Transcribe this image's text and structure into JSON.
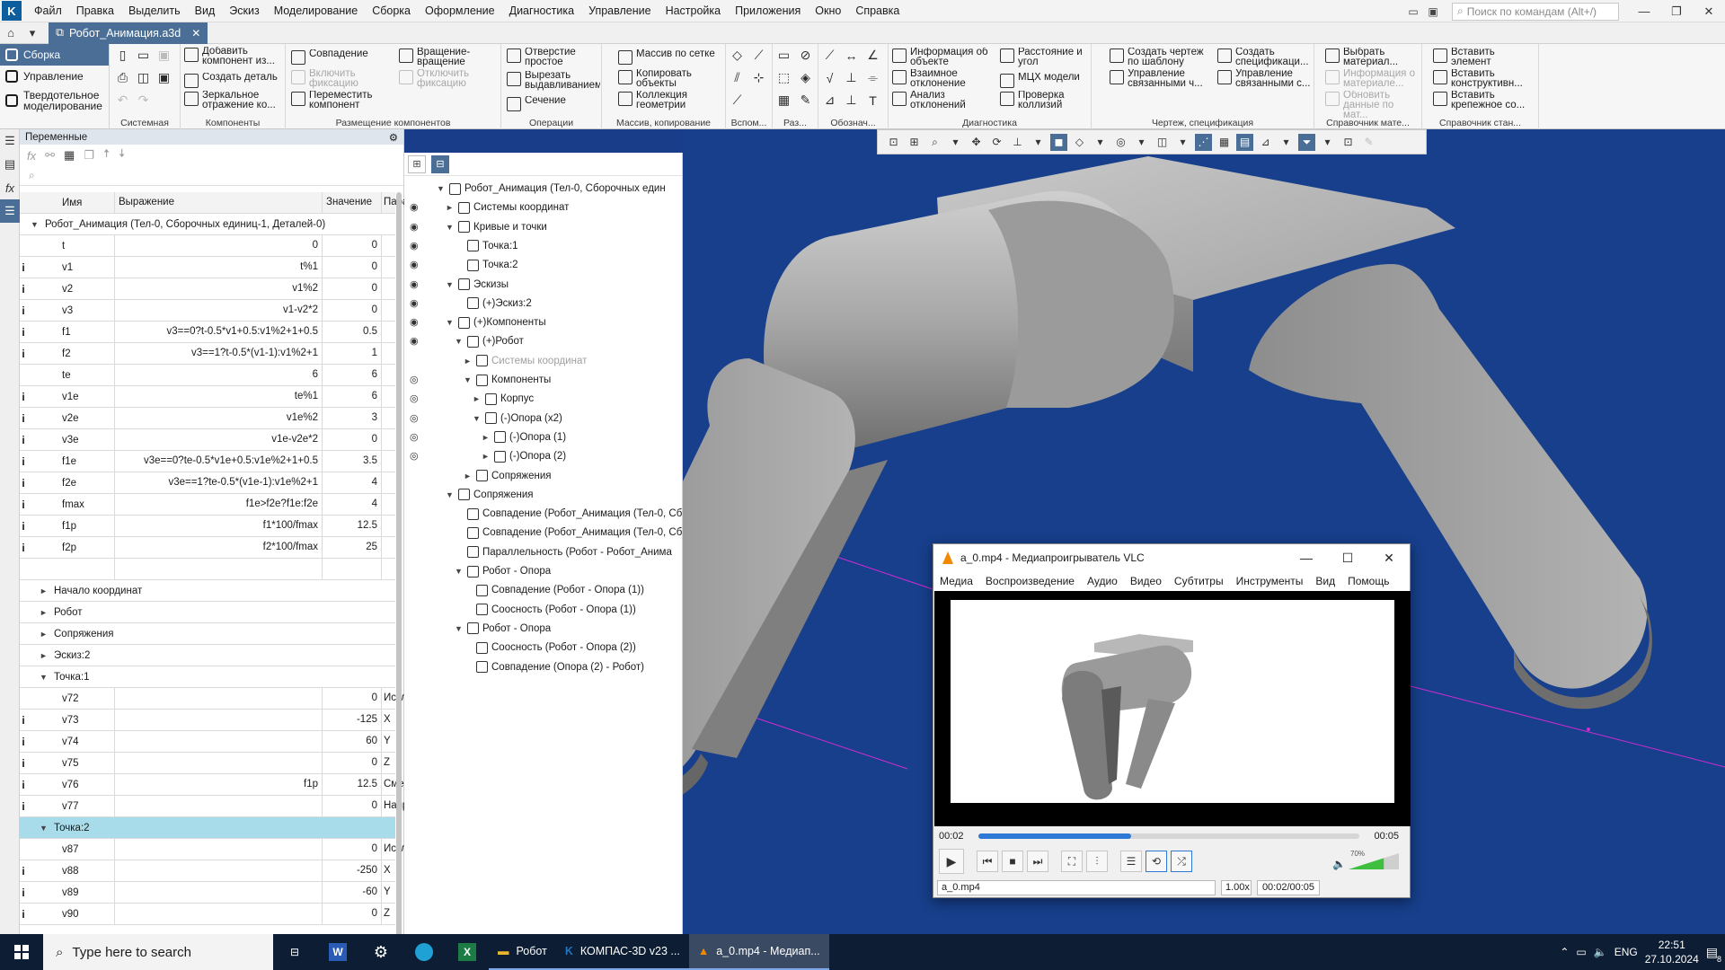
{
  "menubar": {
    "items": [
      "Файл",
      "Правка",
      "Выделить",
      "Вид",
      "Эскиз",
      "Моделирование",
      "Сборка",
      "Оформление",
      "Диагностика",
      "Управление",
      "Настройка",
      "Приложения",
      "Окно",
      "Справка"
    ],
    "search_placeholder": "Поиск по командам (Alt+/)"
  },
  "tab": {
    "title": "Робот_Анимация.a3d"
  },
  "ribbon": {
    "modes": [
      "Сборка",
      "Управление",
      "Твердотельное моделирование"
    ],
    "groups": [
      "Системная",
      "Компоненты",
      "Размещение компонентов",
      "Операции",
      "Массив, копирование",
      "Вспом...",
      "Раз...",
      "Обознач...",
      "Диагностика",
      "Чертеж, спецификация",
      "Справочник мате...",
      "Справочник стан..."
    ],
    "commands": {
      "add_component": "Добавить компонент из...",
      "create_part": "Создать деталь",
      "mirror": "Зеркальное отражение ко...",
      "coincidence": "Совпадение",
      "enable_fix": "Включить фиксацию",
      "disable_fix": "Отключить фиксацию",
      "move_component": "Переместить компонент",
      "rotate": "Вращение-вращение",
      "hole": "Отверстие простое",
      "cut_extrude": "Вырезать выдавливанием",
      "section": "Сечение",
      "pattern_grid": "Массив по сетке",
      "copy_objects": "Копировать объекты",
      "geometry_collection": "Коллекция геометрии",
      "object_info": "Информация об объекте",
      "mutual_deviation": "Взаимное отклонение",
      "deviation_analysis": "Анализ отклонений",
      "distance_angle": "Расстояние и угол",
      "mcc_model": "МЦХ модели",
      "collision_check": "Проверка коллизий",
      "create_drawing": "Создать чертеж по шаблону",
      "control_linked": "Управление связанными ч...",
      "create_spec": "Создать спецификаци...",
      "control_linked2": "Управление связанными с...",
      "choose_material": "Выбрать материал...",
      "material_info": "Информация о материале...",
      "update_material": "Обновить данные по мат...",
      "insert_element": "Вставить элемент",
      "insert_design": "Вставить конструктивн...",
      "insert_fastener": "Вставить крепежное со..."
    }
  },
  "variables": {
    "panel_title": "Переменные",
    "columns": [
      "Имя",
      "Выражение",
      "Значение",
      "Парам"
    ],
    "root_group": "Робот_Анимация (Тел-0, Сборочных единиц-1, Деталей-0)",
    "rows": [
      {
        "i": "",
        "name": "t",
        "expr": "0",
        "val": "0"
      },
      {
        "i": "i",
        "name": "v1",
        "expr": "t%1",
        "val": "0"
      },
      {
        "i": "i",
        "name": "v2",
        "expr": "v1%2",
        "val": "0"
      },
      {
        "i": "i",
        "name": "v3",
        "expr": "v1-v2*2",
        "val": "0"
      },
      {
        "i": "i",
        "name": "f1",
        "expr": "v3==0?t-0.5*v1+0.5:v1%2+1+0.5",
        "val": "0.5"
      },
      {
        "i": "i",
        "name": "f2",
        "expr": "v3==1?t-0.5*(v1-1):v1%2+1",
        "val": "1"
      },
      {
        "i": "",
        "name": "te",
        "expr": "6",
        "val": "6"
      },
      {
        "i": "i",
        "name": "v1e",
        "expr": "te%1",
        "val": "6"
      },
      {
        "i": "i",
        "name": "v2e",
        "expr": "v1e%2",
        "val": "3"
      },
      {
        "i": "i",
        "name": "v3e",
        "expr": "v1e-v2e*2",
        "val": "0"
      },
      {
        "i": "i",
        "name": "f1e",
        "expr": "v3e==0?te-0.5*v1e+0.5:v1e%2+1+0.5",
        "val": "3.5"
      },
      {
        "i": "i",
        "name": "f2e",
        "expr": "v3e==1?te-0.5*(v1e-1):v1e%2+1",
        "val": "4"
      },
      {
        "i": "i",
        "name": "fmax",
        "expr": "f1e>f2e?f1e:f2e",
        "val": "4"
      },
      {
        "i": "i",
        "name": "f1p",
        "expr": "f1*100/fmax",
        "val": "12.5"
      },
      {
        "i": "i",
        "name": "f2p",
        "expr": "f2*100/fmax",
        "val": "25"
      }
    ],
    "groups": [
      "Начало координат",
      "Робот",
      "Сопряжения",
      "Эскиз:2"
    ],
    "point1": {
      "label": "Точка:1",
      "rows": [
        {
          "i": "",
          "name": "v72",
          "expr": "",
          "val": "0",
          "par": "Искл"
        },
        {
          "i": "i",
          "name": "v73",
          "expr": "",
          "val": "-125",
          "par": "X"
        },
        {
          "i": "i",
          "name": "v74",
          "expr": "",
          "val": "60",
          "par": "Y"
        },
        {
          "i": "i",
          "name": "v75",
          "expr": "",
          "val": "0",
          "par": "Z"
        },
        {
          "i": "i",
          "name": "v76",
          "expr": "f1p",
          "val": "12.5",
          "par": "Смещ"
        },
        {
          "i": "i",
          "name": "v77",
          "expr": "",
          "val": "0",
          "par": "Напр"
        }
      ]
    },
    "point2": {
      "label": "Точка:2",
      "rows": [
        {
          "i": "",
          "name": "v87",
          "expr": "",
          "val": "0",
          "par": "Искл"
        },
        {
          "i": "i",
          "name": "v88",
          "expr": "",
          "val": "-250",
          "par": "X"
        },
        {
          "i": "i",
          "name": "v89",
          "expr": "",
          "val": "-60",
          "par": "Y"
        },
        {
          "i": "i",
          "name": "v90",
          "expr": "",
          "val": "0",
          "par": "Z"
        }
      ]
    }
  },
  "tree": {
    "nodes": [
      {
        "text": "Робот_Анимация (Тел-0, Сборочных един",
        "level": 0,
        "arrow": "▼",
        "eye": ""
      },
      {
        "text": "Системы координат",
        "level": 1,
        "arrow": "►",
        "eye": "◉"
      },
      {
        "text": "Кривые и точки",
        "level": 1,
        "arrow": "▼",
        "eye": "◉"
      },
      {
        "text": "Точка:1",
        "level": 2,
        "arrow": "",
        "eye": "◉"
      },
      {
        "text": "Точка:2",
        "level": 2,
        "arrow": "",
        "eye": "◉"
      },
      {
        "text": "Эскизы",
        "level": 1,
        "arrow": "▼",
        "eye": "◉"
      },
      {
        "text": "(+)Эскиз:2",
        "level": 2,
        "arrow": "",
        "eye": "◉"
      },
      {
        "text": "(+)Компоненты",
        "level": 1,
        "arrow": "▼",
        "eye": "◉"
      },
      {
        "text": "(+)Робот",
        "level": 2,
        "arrow": "▼",
        "eye": "◉"
      },
      {
        "text": "Системы координат",
        "level": 3,
        "arrow": "►",
        "eye": "",
        "dim": true
      },
      {
        "text": "Компоненты",
        "level": 3,
        "arrow": "▼",
        "eye": "◎"
      },
      {
        "text": "Корпус",
        "level": 4,
        "arrow": "►",
        "eye": "◎"
      },
      {
        "text": "(-)Опора (x2)",
        "level": 4,
        "arrow": "▼",
        "eye": "◎"
      },
      {
        "text": "(-)Опора (1)",
        "level": 5,
        "arrow": "►",
        "eye": "◎"
      },
      {
        "text": "(-)Опора (2)",
        "level": 5,
        "arrow": "►",
        "eye": "◎"
      },
      {
        "text": "Сопряжения",
        "level": 3,
        "arrow": "►",
        "eye": ""
      },
      {
        "text": "Сопряжения",
        "level": 1,
        "arrow": "▼",
        "eye": ""
      },
      {
        "text": "Совпадение (Робот_Анимация (Тел-0, Сб",
        "level": 2,
        "arrow": "",
        "eye": ""
      },
      {
        "text": "Совпадение (Робот_Анимация (Тел-0, Сб",
        "level": 2,
        "arrow": "",
        "eye": ""
      },
      {
        "text": "Параллельность (Робот - Робот_Анима",
        "level": 2,
        "arrow": "",
        "eye": ""
      },
      {
        "text": "Робот - Опора",
        "level": 2,
        "arrow": "▼",
        "eye": ""
      },
      {
        "text": "Совпадение (Робот - Опора (1))",
        "level": 3,
        "arrow": "",
        "eye": ""
      },
      {
        "text": "Соосность (Робот - Опора (1))",
        "level": 3,
        "arrow": "",
        "eye": ""
      },
      {
        "text": "Робот - Опора",
        "level": 2,
        "arrow": "▼",
        "eye": ""
      },
      {
        "text": "Соосность (Робот - Опора (2))",
        "level": 3,
        "arrow": "",
        "eye": ""
      },
      {
        "text": "Совпадение (Опора (2) - Робот)",
        "level": 3,
        "arrow": "",
        "eye": ""
      }
    ]
  },
  "vlc": {
    "title": "a_0.mp4 - Медиапроигрыватель VLC",
    "menu": [
      "Медиа",
      "Воспроизведение",
      "Аудио",
      "Видео",
      "Субтитры",
      "Инструменты",
      "Вид",
      "Помощь"
    ],
    "elapsed": "00:02",
    "total": "00:05",
    "progress": 0.4,
    "volume": "70%",
    "volume_level": 0.7,
    "filename": "a_0.mp4",
    "speed": "1.00x",
    "time_status": "00:02/00:05"
  },
  "taskbar": {
    "search_placeholder": "Type here to search",
    "tasks": [
      "Робот",
      "КОМПАС-3D v23 ...",
      "a_0.mp4 - Медиап..."
    ],
    "lang": "ENG",
    "time": "22:51",
    "date": "27.10.2024",
    "notifications": "8"
  },
  "colors": {
    "accent": "#4a6e96",
    "viewport_bg": "#173f8b",
    "selected_row": "#a9dcea",
    "vlc_progress": "#2f79d6",
    "volume_green": "#3fbf3f"
  }
}
